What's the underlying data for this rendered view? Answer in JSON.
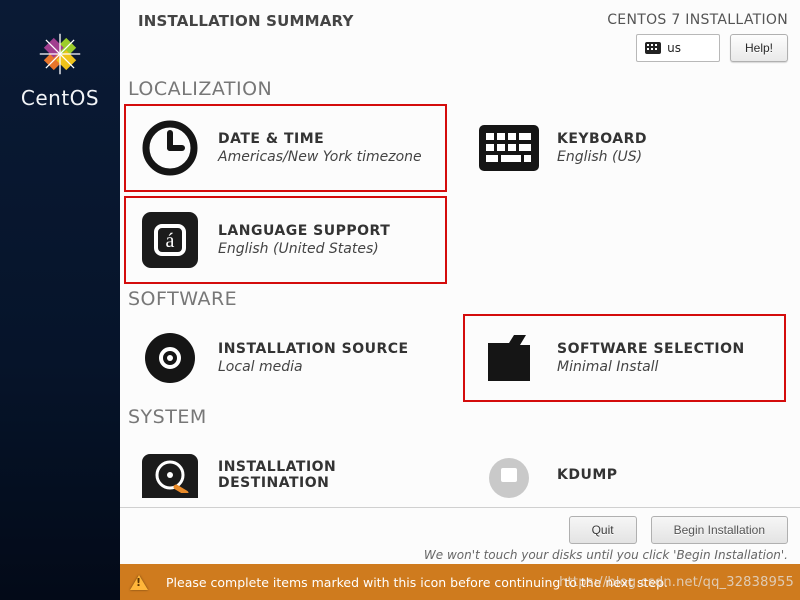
{
  "brand": "CentOS",
  "header": {
    "title": "INSTALLATION SUMMARY",
    "install_label": "CENTOS 7 INSTALLATION",
    "keyboard_layout": "us",
    "help_label": "Help!"
  },
  "sections": {
    "localization": "LOCALIZATION",
    "software": "SOFTWARE",
    "system": "SYSTEM"
  },
  "spokes": {
    "datetime": {
      "title": "DATE & TIME",
      "status": "Americas/New York timezone"
    },
    "keyboard": {
      "title": "KEYBOARD",
      "status": "English (US)"
    },
    "language": {
      "title": "LANGUAGE SUPPORT",
      "status": "English (United States)"
    },
    "source": {
      "title": "INSTALLATION SOURCE",
      "status": "Local media"
    },
    "software": {
      "title": "SOFTWARE SELECTION",
      "status": "Minimal Install"
    },
    "destination": {
      "title": "INSTALLATION DESTINATION",
      "status": ""
    },
    "kdump": {
      "title": "KDUMP",
      "status": ""
    }
  },
  "buttons": {
    "quit": "Quit",
    "begin": "Begin Installation",
    "hint": "We won't touch your disks until you click 'Begin Installation'."
  },
  "warning": "Please complete items marked with this icon before continuing to the next step.",
  "watermark": "https://blog.csdn.net/qq_32838955"
}
